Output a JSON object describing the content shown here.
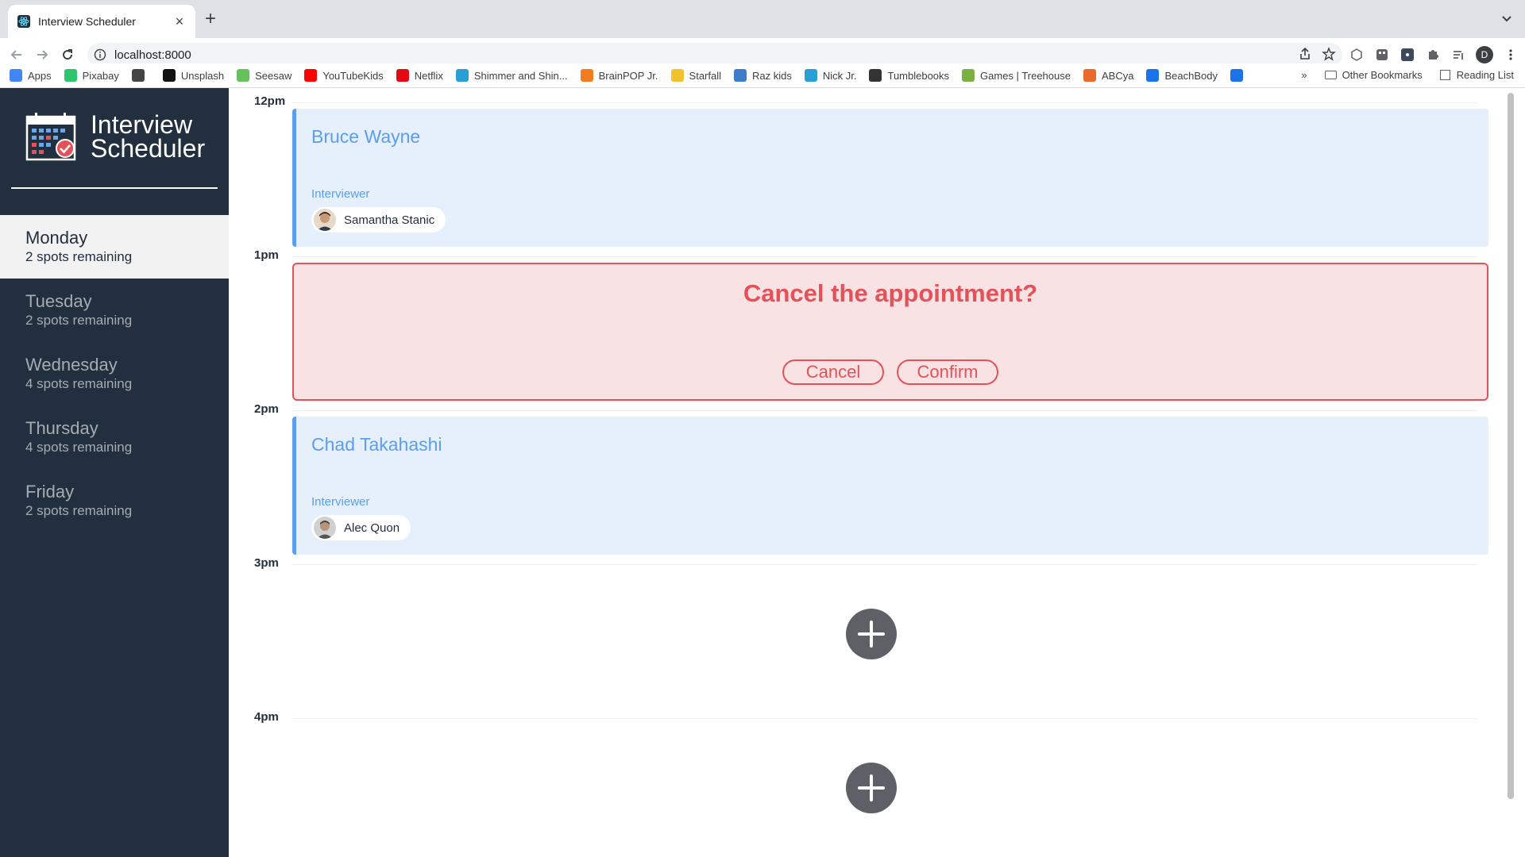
{
  "browser": {
    "tab_title": "Interview Scheduler",
    "new_tab_symbol": "+",
    "url": "localhost:8000",
    "profile_initial": "D",
    "bookmarks": [
      {
        "label": "Apps",
        "color": "#4285f4"
      },
      {
        "label": "Pixabay",
        "color": "#2ec66d"
      },
      {
        "label": "",
        "color": "#444444"
      },
      {
        "label": "Unsplash",
        "color": "#111111"
      },
      {
        "label": "Seesaw",
        "color": "#65c15b"
      },
      {
        "label": "YouTubeKids",
        "color": "#ff0000"
      },
      {
        "label": "Netflix",
        "color": "#e50914"
      },
      {
        "label": "Shimmer and Shin...",
        "color": "#2a9fd6"
      },
      {
        "label": "BrainPOP Jr.",
        "color": "#f47b20"
      },
      {
        "label": "Starfall",
        "color": "#f2c12e"
      },
      {
        "label": "Raz kids",
        "color": "#3d7dca"
      },
      {
        "label": "Nick Jr.",
        "color": "#2a9fd6"
      },
      {
        "label": "Tumblebooks",
        "color": "#333333"
      },
      {
        "label": "Games | Treehouse",
        "color": "#7bb045"
      },
      {
        "label": "ABCya",
        "color": "#e96a2b"
      },
      {
        "label": "BeachBody",
        "color": "#1a73e8"
      },
      {
        "label": "",
        "color": "#1a73e8"
      }
    ],
    "bookmarks_overflow": "»",
    "other_bookmarks": "Other Bookmarks",
    "reading_list": "Reading List"
  },
  "sidebar": {
    "logo_line1": "Interview",
    "logo_line2": "Scheduler",
    "days": [
      {
        "name": "Monday",
        "spots": "2 spots remaining",
        "selected": true
      },
      {
        "name": "Tuesday",
        "spots": "2 spots remaining",
        "selected": false
      },
      {
        "name": "Wednesday",
        "spots": "4 spots remaining",
        "selected": false
      },
      {
        "name": "Thursday",
        "spots": "4 spots remaining",
        "selected": false
      },
      {
        "name": "Friday",
        "spots": "2 spots remaining",
        "selected": false
      }
    ]
  },
  "schedule": {
    "slots": [
      {
        "time": "12pm",
        "mode": "show",
        "student": "Bruce Wayne",
        "interviewer_label": "Interviewer",
        "interviewer": "Samantha Stanic"
      },
      {
        "time": "1pm",
        "mode": "confirm",
        "message": "Cancel the appointment?",
        "cancel_label": "Cancel",
        "confirm_label": "Confirm"
      },
      {
        "time": "2pm",
        "mode": "show",
        "student": "Chad Takahashi",
        "interviewer_label": "Interviewer",
        "interviewer": "Alec Quon"
      },
      {
        "time": "3pm",
        "mode": "empty"
      },
      {
        "time": "4pm",
        "mode": "empty"
      }
    ]
  },
  "colors": {
    "sidebar_bg": "#222f3e",
    "accent_blue": "#5c9ded",
    "danger_red": "#e35258",
    "add_button": "#5d6066"
  }
}
